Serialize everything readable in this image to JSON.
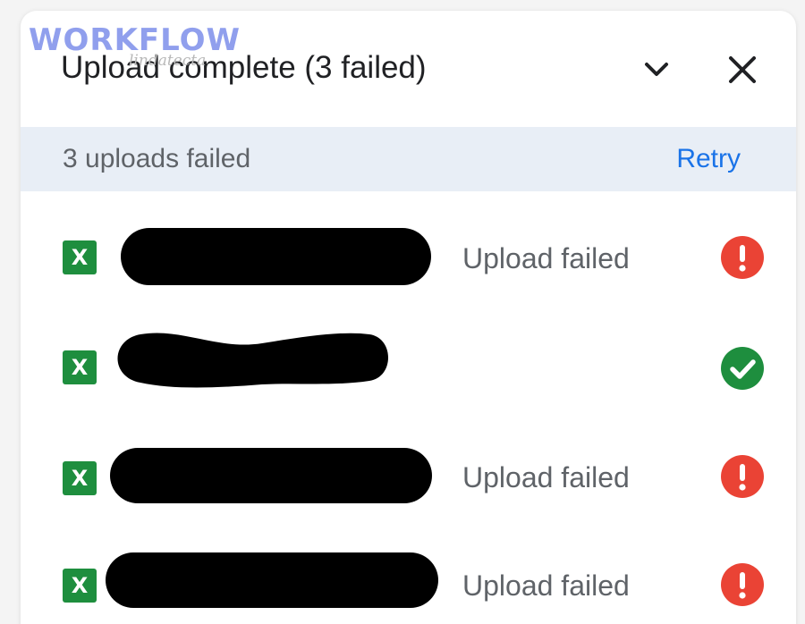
{
  "watermark": {
    "logo_text": "WORKFLOW",
    "sub_text": "lindatecta"
  },
  "header": {
    "title": "Upload complete (3 failed)",
    "collapse_icon": "chevron-down-icon",
    "close_icon": "close-icon"
  },
  "summary": {
    "text": "3 uploads failed",
    "retry_label": "Retry",
    "retry_color": "#1a73e8"
  },
  "files": [
    {
      "icon": "excel-file-icon",
      "icon_letter": "X",
      "name_redacted": true,
      "status": "Upload failed",
      "state": "error"
    },
    {
      "icon": "excel-file-icon",
      "icon_letter": "X",
      "name_redacted": true,
      "status": "",
      "state": "success"
    },
    {
      "icon": "excel-file-icon",
      "icon_letter": "X",
      "name_redacted": true,
      "status": "Upload failed",
      "state": "error"
    },
    {
      "icon": "excel-file-icon",
      "icon_letter": "X",
      "name_redacted": true,
      "status": "Upload failed",
      "state": "error"
    }
  ],
  "colors": {
    "error": "#ea4335",
    "success": "#1e8e3e",
    "excel": "#1e8e3e",
    "subbar_bg": "#e8eef6"
  }
}
